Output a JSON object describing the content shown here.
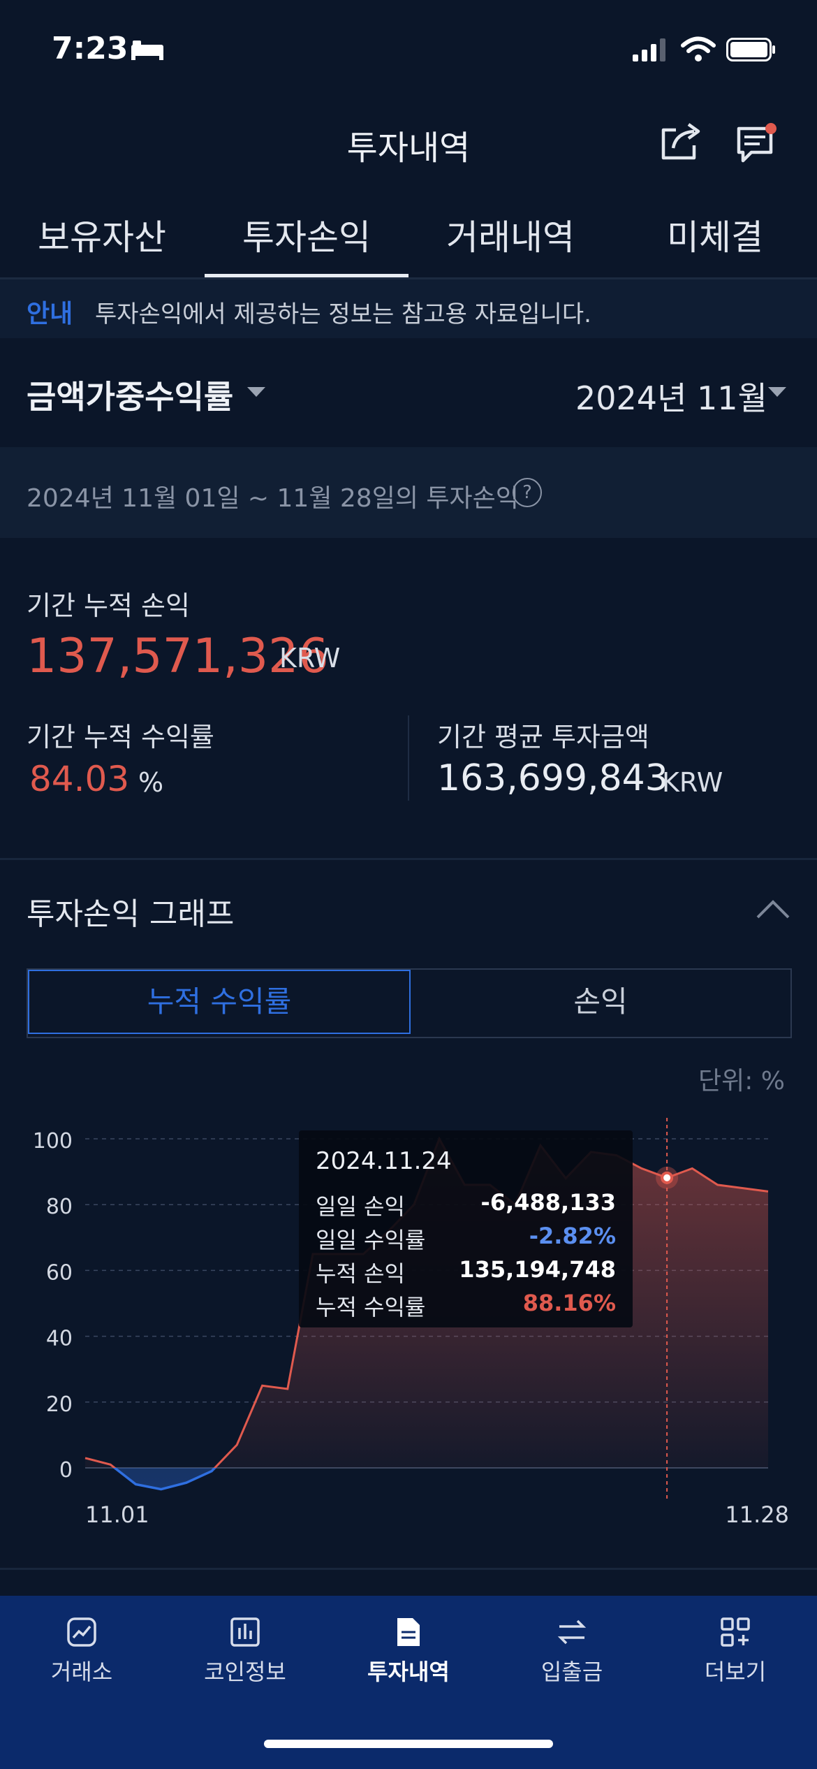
{
  "status_bar": {
    "time": "7:23"
  },
  "header": {
    "title": "투자내역",
    "icons": [
      "share-icon",
      "chat-icon"
    ]
  },
  "tabs": [
    {
      "label": "보유자산"
    },
    {
      "label": "투자손익",
      "active": true
    },
    {
      "label": "거래내역"
    },
    {
      "label": "미체결"
    }
  ],
  "notice": {
    "tag": "안내",
    "text": "투자손익에서 제공하는 정보는 참고용 자료입니다."
  },
  "filters": {
    "metric": "금액가중수익률",
    "month": "2024년 11월"
  },
  "period": {
    "text": "2024년 11월 01일 ~ 11월 28일의 투자손익"
  },
  "summary": {
    "cum_pl_label": "기간 누적 손익",
    "cum_pl_value": "137,571,326",
    "cum_pl_unit": "KRW",
    "cum_rate_label": "기간 누적 수익률",
    "cum_rate_value": "84.03",
    "cum_rate_unit": "%",
    "avg_invest_label": "기간 평균 투자금액",
    "avg_invest_value": "163,699,843",
    "avg_invest_unit": "KRW"
  },
  "graph": {
    "title": "투자손익 그래프",
    "toggle_active": "누적 수익률",
    "toggle_other": "손익",
    "unit_label": "단위: %"
  },
  "tooltip": {
    "date": "2024.11.24",
    "rows": [
      {
        "label": "일일 손익",
        "value": "-6,488,133",
        "color": "#ffffff"
      },
      {
        "label": "일일 수익률",
        "value": "-2.82%",
        "color": "#5b8ff0"
      },
      {
        "label": "누적 손익",
        "value": "135,194,748",
        "color": "#ffffff"
      },
      {
        "label": "누적 수익률",
        "value": "88.16%",
        "color": "#e05a4e"
      }
    ]
  },
  "chart_data": {
    "type": "area",
    "x_start_label": "11.01",
    "x_end_label": "11.28",
    "yticks": [
      0,
      20,
      40,
      60,
      80,
      100
    ],
    "ylim": [
      -7,
      100
    ],
    "grid": true,
    "x": [
      1,
      2,
      3,
      4,
      5,
      6,
      7,
      8,
      9,
      10,
      11,
      12,
      13,
      14,
      15,
      16,
      17,
      18,
      19,
      20,
      21,
      22,
      23,
      24,
      25,
      26,
      27,
      28
    ],
    "values": [
      3,
      1,
      -5,
      -6.5,
      -4.5,
      -1,
      7,
      25,
      24,
      65,
      65,
      65,
      72,
      80,
      100,
      86,
      86,
      80,
      98,
      88,
      96,
      95,
      91,
      88.16,
      91,
      86,
      85,
      84
    ],
    "highlight_index": 23,
    "colors": {
      "positive": "#e05a4e",
      "negative": "#2f6fe0",
      "grid": "#3a4760"
    }
  },
  "navbar": {
    "items": [
      {
        "label": "거래소",
        "icon": "exchange-chart-icon"
      },
      {
        "label": "코인정보",
        "icon": "bar-chart-icon"
      },
      {
        "label": "투자내역",
        "icon": "document-icon",
        "active": true
      },
      {
        "label": "입출금",
        "icon": "transfer-arrows-icon"
      },
      {
        "label": "더보기",
        "icon": "grid-plus-icon"
      }
    ]
  }
}
